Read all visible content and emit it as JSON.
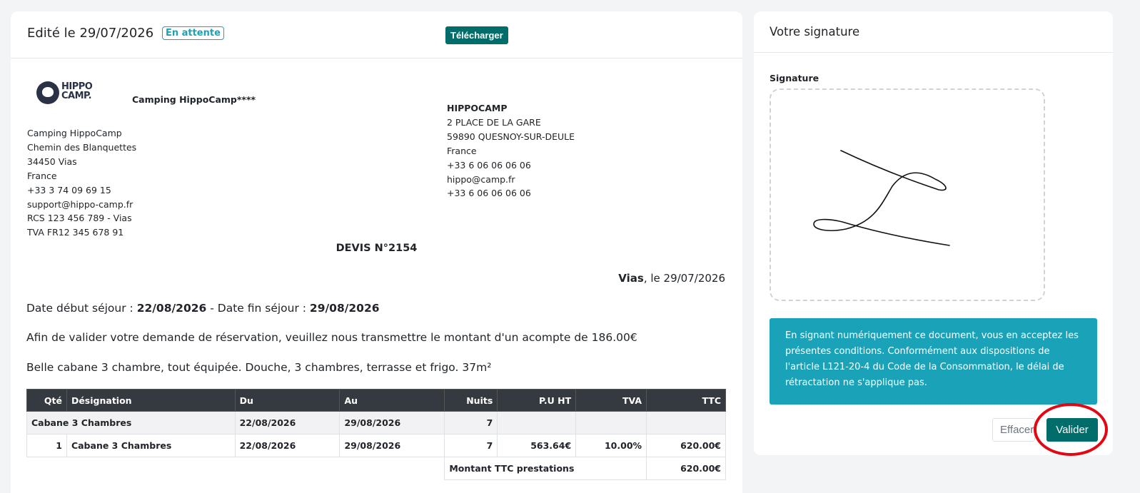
{
  "header": {
    "title": "Edité le 29/07/2026",
    "status": "En attente",
    "download_label": "Télécharger"
  },
  "logo": {
    "text_line1": "HIPPO",
    "text_line2": "CAMP."
  },
  "company_name": "Camping HippoCamp****",
  "sender": {
    "lines": [
      "Camping HippoCamp",
      "Chemin des Blanquettes",
      "34450 Vias",
      "France",
      "+33 3 74 09 69 15",
      "support@hippo-camp.fr",
      "RCS 123 456 789 - Vias",
      "TVA FR12 345 678 91"
    ]
  },
  "client": {
    "name": "HIPPOCAMP",
    "lines": [
      "2 PLACE DE LA GARE",
      "59890 QUESNOY-SUR-DEULE",
      "France",
      "+33 6 06 06 06 06",
      "hippo@camp.fr",
      "+33 6 06 06 06 06"
    ]
  },
  "quote": {
    "number": "DEVIS N°2154",
    "place": "Vias",
    "date_text": ", le 29/07/2026",
    "start_label": "Date début séjour : ",
    "start_date": "22/08/2026",
    "sep": " - Date fin séjour : ",
    "end_date": "29/08/2026",
    "deposit_text": "Afin de valider votre demande de réservation, veuillez nous transmettre le montant d'un acompte de 186.00€",
    "description": "Belle cabane 3 chambre, tout équipée. Douche, 3 chambres, terrasse et frigo. 37m²"
  },
  "table": {
    "headers": [
      "Qté",
      "Désignation",
      "Du",
      "Au",
      "Nuits",
      "P.U HT",
      "TVA",
      "TTC"
    ],
    "group_row": [
      "Cabane 3 Chambres",
      "22/08/2026",
      "29/08/2026",
      "7"
    ],
    "item_row": [
      "1",
      "Cabane 3 Chambres",
      "22/08/2026",
      "29/08/2026",
      "7",
      "563.64€",
      "10.00%",
      "620.00€"
    ],
    "total_label": "Montant TTC prestations",
    "total_value": "620.00€"
  },
  "signature": {
    "title": "Votre signature",
    "label": "Signature",
    "notice": "En signant numériquement ce document, vous en acceptez les présentes conditions. Conformément aux dispositions de l'article L121-20-4 du Code de la Consommation, le délai de rétractation ne s'applique pas.",
    "clear_label": "Effacer",
    "validate_label": "Valider"
  },
  "colors": {
    "primary": "#006d6a",
    "info": "#1aa3b8",
    "table_header": "#343a40",
    "highlight": "#e30613"
  }
}
